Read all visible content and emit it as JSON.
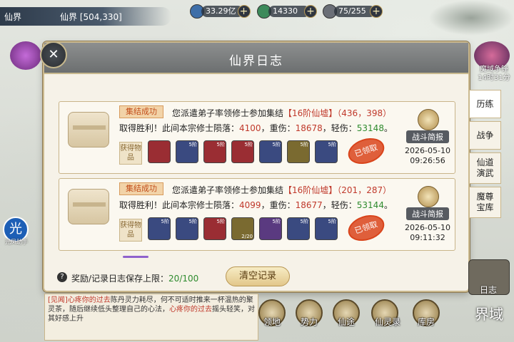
{
  "topbar": {
    "location_name": "仙界",
    "location_coord": "仙界 [504,330]",
    "resources": [
      {
        "icon": "spirit-stone-icon",
        "value": "33.29亿",
        "color": "#3d6ea8"
      },
      {
        "icon": "jade-icon",
        "value": "14330",
        "color": "#3c8a5a"
      },
      {
        "icon": "stamina-icon",
        "value": "75/255",
        "color": "#6b6f77"
      }
    ],
    "plus": "+"
  },
  "modal": {
    "title": "仙界日志",
    "close": "✕",
    "entries": [
      {
        "tag": "集结成功",
        "line1_prefix": "您派遣弟子率领修士参加集结",
        "line1_target": "【16阶仙墟】（436，398）",
        "line2_prefix": "取得胜利！此间本宗修士陨落：",
        "fallen": "4100",
        "heavy_label": "，重伤：",
        "heavy": "18678",
        "light_label": "，轻伤：",
        "light": "53148",
        "period": "。",
        "obtain": "获得物品",
        "items": [
          {
            "icon": "blade-icon",
            "color": "#9a2d33",
            "level": "",
            "qty": ""
          },
          {
            "icon": "armor-icon",
            "color": "#3a4a80",
            "level": "5阶",
            "qty": ""
          },
          {
            "icon": "helmet-icon",
            "color": "#9a2d33",
            "level": "5阶",
            "qty": ""
          },
          {
            "icon": "gourd-icon",
            "color": "#9a2d33",
            "level": "5阶",
            "qty": ""
          },
          {
            "icon": "robe-icon",
            "color": "#3a4a80",
            "level": "5阶",
            "qty": ""
          },
          {
            "icon": "charm-icon",
            "color": "#7a6a30",
            "level": "5阶",
            "qty": ""
          },
          {
            "icon": "pill-icon",
            "color": "#3a4a80",
            "level": "5阶",
            "qty": ""
          }
        ],
        "claimed": "已领取",
        "report": "战斗简报",
        "date": "2026-05-10",
        "time": "09:26:56"
      },
      {
        "tag": "集结成功",
        "line1_prefix": "您派遣弟子率领修士参加集结",
        "line1_target": "【16阶仙墟】（201，287）",
        "line2_prefix": "取得胜利！此间本宗修士陨落：",
        "fallen": "4099",
        "heavy_label": "，重伤：",
        "heavy": "18677",
        "light_label": "，轻伤：",
        "light": "53144",
        "period": "。",
        "obtain": "获得物品",
        "items": [
          {
            "icon": "sword-icon",
            "color": "#3a4a80",
            "level": "5阶",
            "qty": ""
          },
          {
            "icon": "spade-icon",
            "color": "#3a4a80",
            "level": "5阶",
            "qty": ""
          },
          {
            "icon": "ornament-icon",
            "color": "#9a2d33",
            "level": "5阶",
            "qty": ""
          },
          {
            "icon": "scroll-icon",
            "color": "#7a6a30",
            "level": "",
            "qty": "2/20"
          },
          {
            "icon": "orb-icon",
            "color": "#5a3a80",
            "level": "5阶",
            "qty": ""
          },
          {
            "icon": "robe-icon",
            "color": "#3a4a80",
            "level": "5阶",
            "qty": ""
          },
          {
            "icon": "armor-icon",
            "color": "#3a4a80",
            "level": "5阶",
            "qty": ""
          }
        ],
        "claimed": "已领取",
        "report": "战斗简报",
        "date": "2026-05-10",
        "time": "09:11:32"
      }
    ],
    "footer_label": "奖励/记录日志保存上限：",
    "footer_count": "20/100",
    "clear_button": "清空记录",
    "question": "?"
  },
  "tabs": [
    "历练",
    "战争",
    "仙道演武",
    "魔尊宝库"
  ],
  "top_right_label": "魔域争锋\n14时31分",
  "helper": {
    "glyph": "光",
    "label": "光凤助手"
  },
  "log_box": {
    "line1_a": "[见闻]",
    "line1_b": "心疼你的过去",
    "line1_c": "陈丹灵力耗尽，",
    "line2": "何不可适时推来一杯温热的聚灵茶，随后继续低头整理自己的心法，",
    "line2_b": "心疼你的过去",
    "line3": "摇头轻笑，对其好感上升"
  },
  "bottom_nav": [
    "领地",
    "势力",
    "仙途",
    "仙灵录",
    "库房"
  ],
  "right_bottom": {
    "label": "日志",
    "field": "界域"
  }
}
